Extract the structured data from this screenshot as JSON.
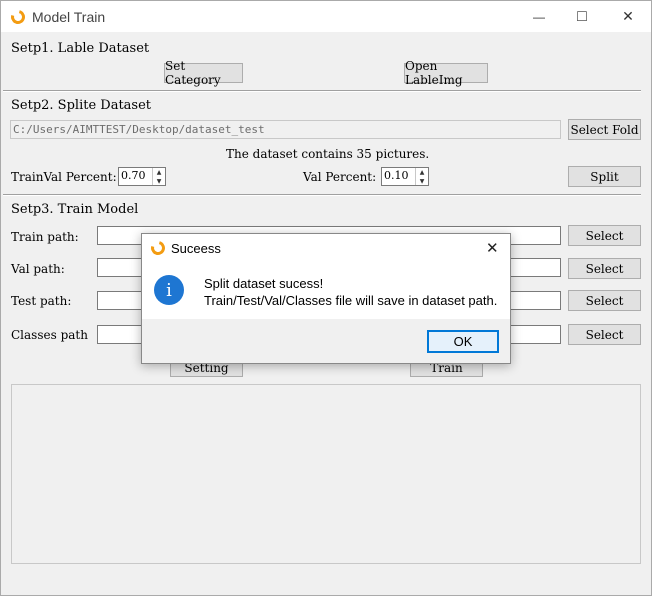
{
  "window": {
    "title": "Model Train",
    "minimize_glyph": "—",
    "maximize_glyph": "□",
    "close_glyph": "✕"
  },
  "step1": {
    "title": "Setp1. Lable Dataset",
    "set_category": "Set Category",
    "open_labelimg": "Open LableImg"
  },
  "step2": {
    "title": "Setp2. Splite Dataset",
    "path_value": "C:/Users/AIMTTEST/Desktop/dataset_test",
    "select_fold": "Select Fold",
    "info": "The dataset contains 35 pictures.",
    "trainval_label": "TrainVal Percent:",
    "trainval_value": "0.70",
    "val_label": "Val Percent:",
    "val_value": "0.10",
    "split": "Split"
  },
  "step3": {
    "title": "Setp3. Train Model",
    "rows": [
      {
        "label": "Train path:",
        "button": "Select"
      },
      {
        "label": "Val  path:",
        "button": "Select"
      },
      {
        "label": "Test  path:",
        "button": "Select"
      },
      {
        "label": "Classes path",
        "button": "Select"
      }
    ],
    "setting": "Setting",
    "train": "Train"
  },
  "dialog": {
    "title": "Suceess",
    "close_glyph": "✕",
    "icon_glyph": "i",
    "line1": "Split dataset sucess!",
    "line2": "Train/Test/Val/Classes file will save in dataset path.",
    "ok": "OK"
  },
  "colors": {
    "accent": "#0078d7",
    "info_icon": "#1e76d2",
    "app_icon": "#f39c12"
  },
  "icons": {
    "app": "model-train-app-icon",
    "info": "info-icon"
  }
}
